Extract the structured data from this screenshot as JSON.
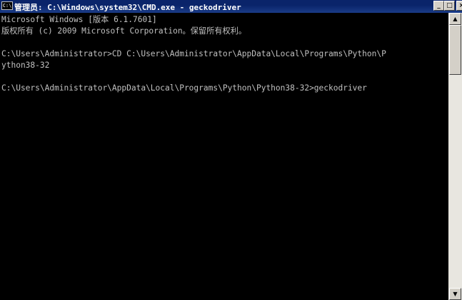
{
  "window": {
    "title": "管理员: C:\\Windows\\system32\\CMD.exe - geckodriver",
    "icon_text": "C:\\",
    "minimize_glyph": "_",
    "maximize_glyph": "□",
    "close_glyph": "×"
  },
  "console": {
    "lines": [
      "Microsoft Windows [版本 6.1.7601]",
      "版权所有 (c) 2009 Microsoft Corporation。保留所有权利。",
      "",
      "C:\\Users\\Administrator>CD C:\\Users\\Administrator\\AppData\\Local\\Programs\\Python\\P",
      "ython38-32",
      "",
      "C:\\Users\\Administrator\\AppData\\Local\\Programs\\Python\\Python38-32>geckodriver"
    ]
  },
  "scrollbar": {
    "up_glyph": "▲",
    "down_glyph": "▼"
  }
}
